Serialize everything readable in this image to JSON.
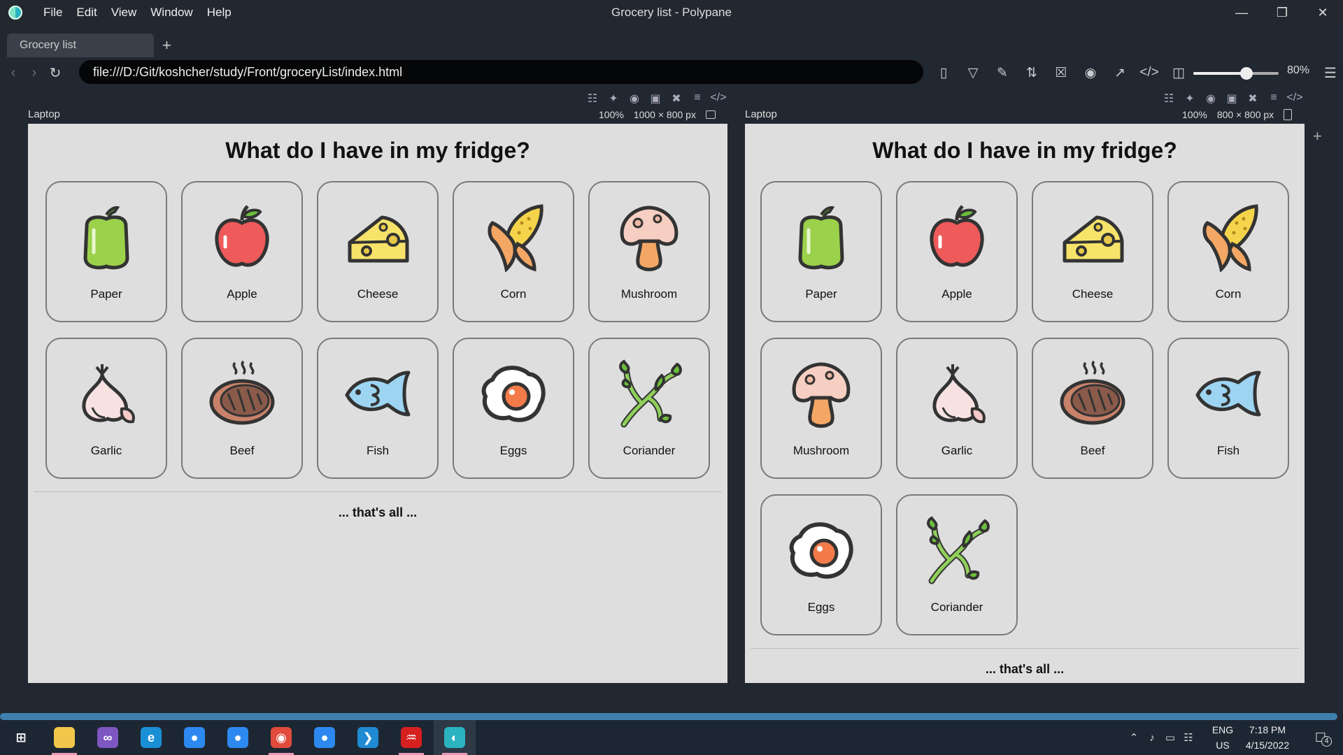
{
  "window": {
    "title": "Grocery list - Polypane",
    "menu": [
      "File",
      "Edit",
      "View",
      "Window",
      "Help"
    ]
  },
  "tabs": [
    {
      "label": "Grocery list"
    }
  ],
  "toolbar": {
    "url": "file:///D:/Git/koshcher/study/Front/groceryList/index.html",
    "zoom_label": "80%",
    "zoom_level": 0.62
  },
  "panes": [
    {
      "label": "Laptop",
      "zoom": "100%",
      "size": "1000 × 800 px"
    },
    {
      "label": "Laptop",
      "zoom": "100%",
      "size": "800 × 800 px"
    }
  ],
  "page": {
    "heading": "What do I have in my fridge?",
    "footer": "... that's all ...",
    "items": [
      {
        "label": "Paper",
        "icon": "pepper-icon"
      },
      {
        "label": "Apple",
        "icon": "apple-icon"
      },
      {
        "label": "Cheese",
        "icon": "cheese-icon"
      },
      {
        "label": "Corn",
        "icon": "corn-icon"
      },
      {
        "label": "Mushroom",
        "icon": "mushroom-icon"
      },
      {
        "label": "Garlic",
        "icon": "garlic-icon"
      },
      {
        "label": "Beef",
        "icon": "beef-icon"
      },
      {
        "label": "Fish",
        "icon": "fish-icon"
      },
      {
        "label": "Eggs",
        "icon": "eggs-icon"
      },
      {
        "label": "Coriander",
        "icon": "coriander-icon"
      }
    ]
  },
  "taskbar": {
    "apps": [
      "start-icon",
      "file-explorer-icon",
      "visual-studio-icon",
      "edge-icon",
      "app-icon",
      "app-icon",
      "chrome-icon",
      "app-icon",
      "vscode-icon",
      "acrobat-icon",
      "polypane-icon"
    ],
    "language": "ENG",
    "region": "US",
    "time": "7:18 PM",
    "date": "4/15/2022",
    "notifications": "4"
  },
  "colors": {
    "accent": "#3e7fae",
    "pane_background": "#dedede",
    "chrome_background": "#222831"
  }
}
